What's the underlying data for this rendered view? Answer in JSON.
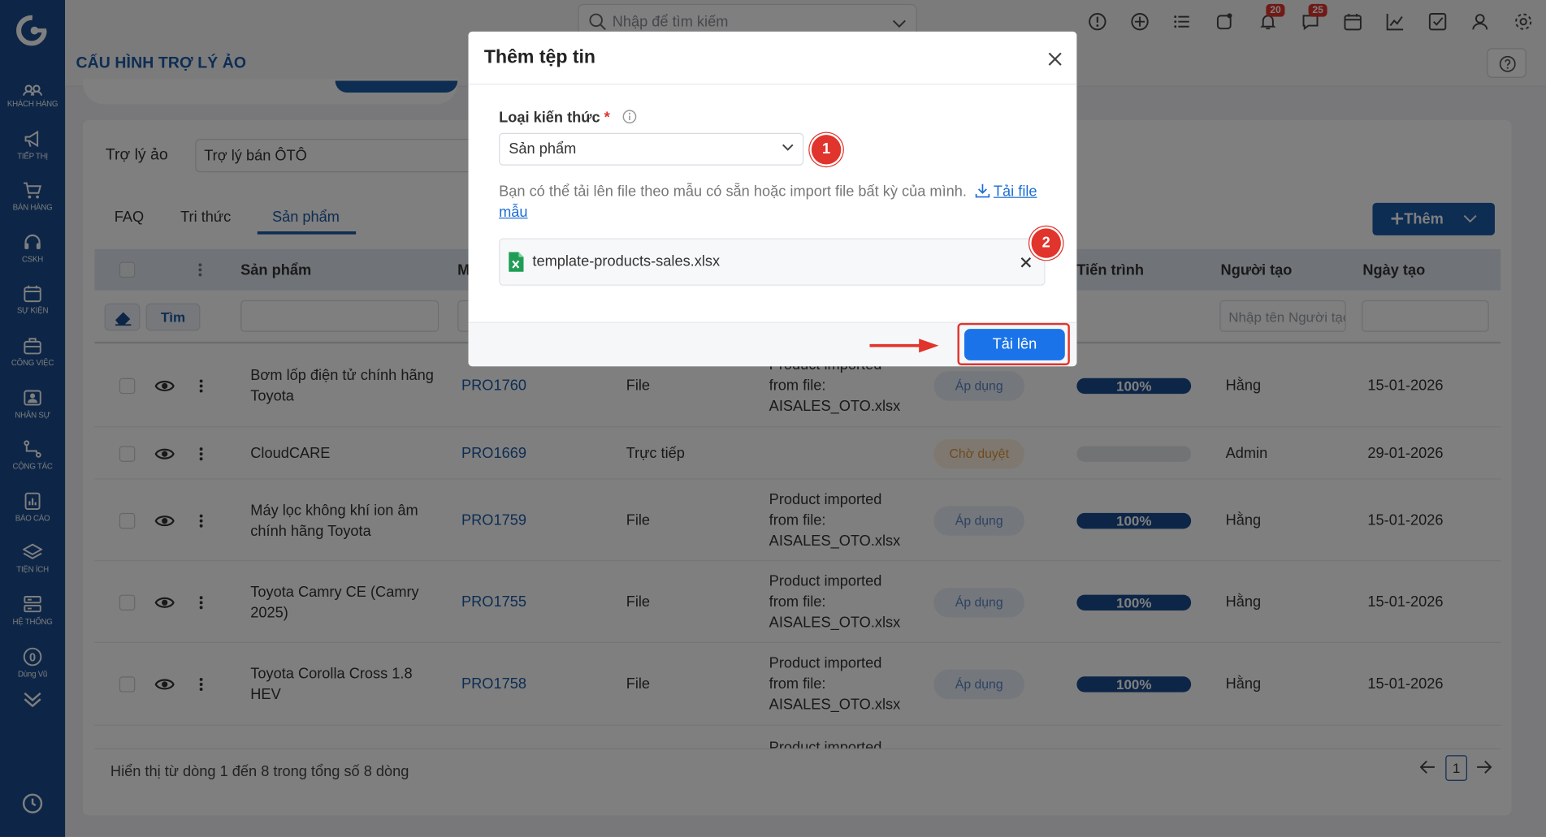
{
  "topbar": {
    "search_placeholder": "Nhập để tìm kiếm",
    "notification_count": "20",
    "message_count": "25"
  },
  "sidebar": {
    "items": [
      {
        "label": "KHÁCH HÀNG",
        "icon": "users-icon"
      },
      {
        "label": "TIẾP THỊ",
        "icon": "megaphone-icon"
      },
      {
        "label": "BÁN HÀNG",
        "icon": "cart-icon"
      },
      {
        "label": "CSKH",
        "icon": "headset-icon"
      },
      {
        "label": "SỰ KIỆN",
        "icon": "calendar-icon"
      },
      {
        "label": "CÔNG VIỆC",
        "icon": "briefcase-icon"
      },
      {
        "label": "NHÂN SỰ",
        "icon": "id-card-icon"
      },
      {
        "label": "CỘNG TÁC",
        "icon": "share-icon"
      },
      {
        "label": "BÁO CÁO",
        "icon": "report-icon"
      },
      {
        "label": "TIỆN ÍCH",
        "icon": "layers-icon"
      },
      {
        "label": "HỆ THỐNG",
        "icon": "server-icon"
      },
      {
        "label": "Dùng Vũ",
        "icon": "zero-circle-icon"
      }
    ]
  },
  "page": {
    "title": "CẤU HÌNH TRỢ LÝ ẢO",
    "assistant_label": "Trợ lý ảo",
    "assistant_value": "Trợ lý bán ÔTÔ",
    "tabs": [
      "FAQ",
      "Tri thức",
      "Sản phẩm"
    ],
    "active_tab": "Sản phẩm",
    "add_button": "Thêm",
    "search_button": "Tìm",
    "creator_filter_placeholder": "Nhập tên Người tạo"
  },
  "table": {
    "columns": {
      "product": "Sản phẩm",
      "code_cut": "M",
      "progress": "Tiến trình",
      "creator": "Người tạo",
      "created_date": "Ngày tạo"
    },
    "rows": [
      {
        "name": "Bơm lốp điện tử chính hãng Toyota",
        "code": "PRO1760",
        "source": "File",
        "note": [
          "Product imported",
          "from file:",
          "AISALES_OTO.xlsx"
        ],
        "status": "Áp dụng",
        "status_type": "apply",
        "progress": "100%",
        "creator": "Hằng",
        "date": "15-01-2026"
      },
      {
        "name": "CloudCARE",
        "code": "PRO1669",
        "source": "Trực tiếp",
        "note": [],
        "status": "Chờ duyệt",
        "status_type": "wait",
        "progress": "",
        "creator": "Admin",
        "date": "29-01-2026"
      },
      {
        "name": "Máy lọc không khí ion âm chính hãng Toyota",
        "code": "PRO1759",
        "source": "File",
        "note": [
          "Product imported",
          "from file:",
          "AISALES_OTO.xlsx"
        ],
        "status": "Áp dụng",
        "status_type": "apply",
        "progress": "100%",
        "creator": "Hằng",
        "date": "15-01-2026"
      },
      {
        "name": "Toyota Camry CE (Camry 2025)",
        "code": "PRO1755",
        "source": "File",
        "note": [
          "Product imported",
          "from file:",
          "AISALES_OTO.xlsx"
        ],
        "status": "Áp dụng",
        "status_type": "apply",
        "progress": "100%",
        "creator": "Hằng",
        "date": "15-01-2026"
      },
      {
        "name": "Toyota Corolla Cross 1.8 HEV",
        "code": "PRO1758",
        "source": "File",
        "note": [
          "Product imported",
          "from file:",
          "AISALES_OTO.xlsx"
        ],
        "status": "Áp dụng",
        "status_type": "apply",
        "progress": "100%",
        "creator": "Hằng",
        "date": "15-01-2026"
      }
    ],
    "partial_row_note": "Product imported",
    "footer": "Hiển thị từ dòng 1 đến 8 trong tổng số 8 dòng",
    "current_page": "1"
  },
  "modal": {
    "title": "Thêm tệp tin",
    "field_label": "Loại kiến thức",
    "required_mark": "*",
    "select_value": "Sản phẩm",
    "hint": "Bạn có thể tải lên file theo mẫu có sẵn hoặc import file bất kỳ của mình.",
    "download_link": "Tải file mẫu",
    "file_name": "template-products-sales.xlsx",
    "upload_button": "Tải lên",
    "step1": "1",
    "step2": "2"
  },
  "colors": {
    "sidebar": "#1a4c8f",
    "primary": "#1a5aa6",
    "upload_button": "#1a73e8",
    "annotation_red": "#e0342c"
  }
}
